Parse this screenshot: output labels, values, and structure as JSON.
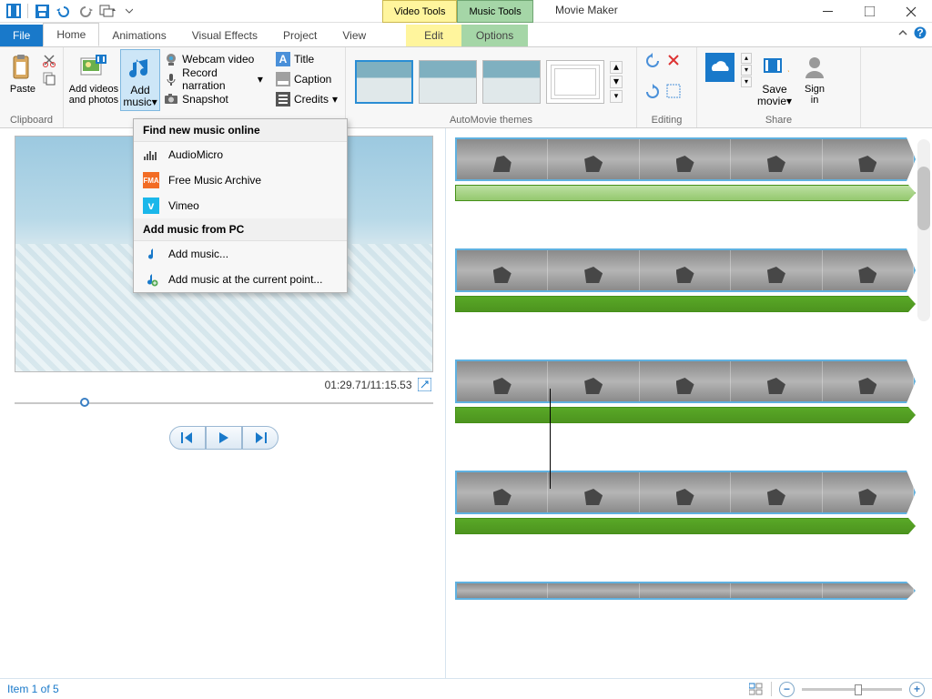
{
  "app_title": "Movie Maker",
  "contextual": {
    "video": "Video Tools",
    "music": "Music Tools",
    "edit": "Edit",
    "options": "Options"
  },
  "tabs": {
    "file": "File",
    "home": "Home",
    "animations": "Animations",
    "visual": "Visual Effects",
    "project": "Project",
    "view": "View"
  },
  "ribbon": {
    "clipboard": {
      "label": "Clipboard",
      "paste": "Paste"
    },
    "add": {
      "videos": "Add videos\nand photos",
      "music": "Add\nmusic",
      "webcam": "Webcam video",
      "narration": "Record narration",
      "snapshot": "Snapshot",
      "title": "Title",
      "caption": "Caption",
      "credits": "Credits"
    },
    "themes": {
      "label": "AutoMovie themes"
    },
    "editing": {
      "label": "Editing"
    },
    "share": {
      "label": "Share",
      "save": "Save\nmovie",
      "signin": "Sign\nin"
    }
  },
  "dropdown": {
    "h1": "Find new music online",
    "items1": [
      "AudioMicro",
      "Free Music Archive",
      "Vimeo"
    ],
    "h2": "Add music from PC",
    "items2": [
      "Add music...",
      "Add music at the current point..."
    ]
  },
  "preview": {
    "timecode": "01:29.71/11:15.53"
  },
  "status": {
    "item": "Item 1 of 5"
  },
  "colors": {
    "accent": "#1979ca",
    "clip_border": "#5fb1e0",
    "audio": "#4d941f"
  }
}
